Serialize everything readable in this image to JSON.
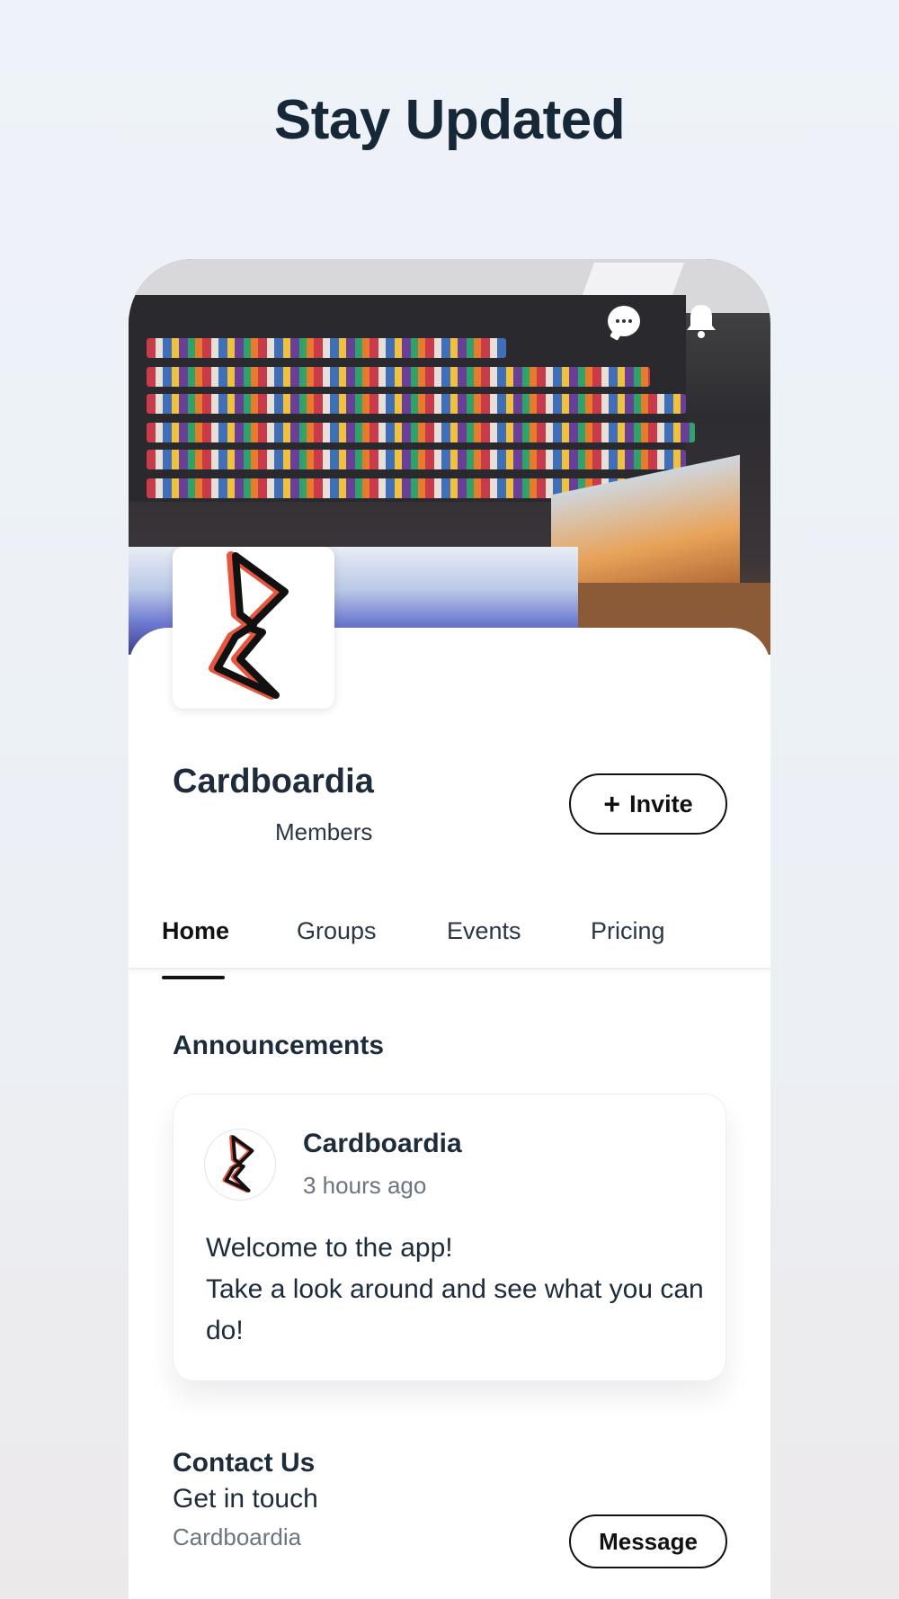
{
  "headline": "Stay Updated",
  "header_icons": [
    "chat-icon",
    "bell-icon"
  ],
  "profile": {
    "name": "Cardboardia",
    "members_label": "Members",
    "invite_label": "Invite"
  },
  "tabs": [
    {
      "label": "Home",
      "active": true
    },
    {
      "label": "Groups",
      "active": false
    },
    {
      "label": "Events",
      "active": false
    },
    {
      "label": "Pricing",
      "active": false
    }
  ],
  "announcements": {
    "title": "Announcements",
    "post": {
      "author": "Cardboardia",
      "time": "3 hours ago",
      "lines": [
        "Welcome to the app!",
        "Take a look around and see what you can do!"
      ]
    }
  },
  "contact": {
    "title": "Contact Us",
    "subtitle": "Get in touch",
    "name": "Cardboardia",
    "message_label": "Message"
  },
  "colors": {
    "text_primary": "#1d2b3a",
    "text_secondary": "#6b7580",
    "logo_accent": "#e8553f",
    "background": "#eef3f9"
  }
}
